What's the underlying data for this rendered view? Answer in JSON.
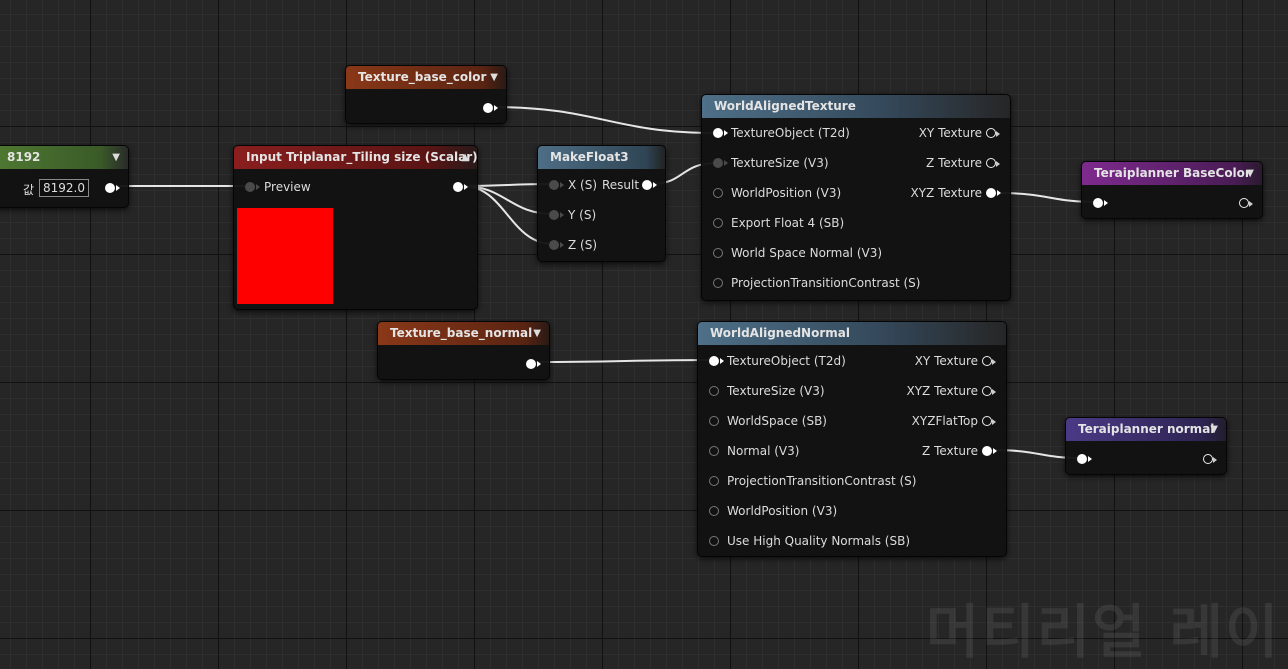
{
  "nodes": {
    "scalar_value": {
      "title": "8192",
      "value_label": "값",
      "value": "8192.0"
    },
    "tiling_param": {
      "title": "Input Triplanar_Tiling size (Scalar)",
      "pin_preview": "Preview",
      "preview_color": "#ff0000"
    },
    "make_float3": {
      "title": "MakeFloat3",
      "pin_x": "X (S)",
      "pin_y": "Y (S)",
      "pin_z": "Z (S)",
      "pin_result": "Result"
    },
    "texture_base_color": {
      "title": "Texture_base_color"
    },
    "texture_base_normal": {
      "title": "Texture_base_normal"
    },
    "world_aligned_texture": {
      "title": "WorldAlignedTexture",
      "inputs": [
        "TextureObject (T2d)",
        "TextureSize (V3)",
        "WorldPosition (V3)",
        "Export Float 4 (SB)",
        "World Space Normal (V3)",
        "ProjectionTransitionContrast (S)"
      ],
      "outputs": [
        "XY Texture",
        "Z Texture",
        "XYZ Texture"
      ]
    },
    "world_aligned_normal": {
      "title": "WorldAlignedNormal",
      "inputs": [
        "TextureObject (T2d)",
        "TextureSize (V3)",
        "WorldSpace (SB)",
        "Normal (V3)",
        "ProjectionTransitionContrast (S)",
        "WorldPosition (V3)",
        "Use High Quality Normals (SB)"
      ],
      "outputs": [
        "XY Texture",
        "XYZ Texture",
        "XYZFlatTop",
        "Z Texture"
      ]
    },
    "terrain_base_color": {
      "title": "Teraiplanner BaseColor"
    },
    "terrain_normal": {
      "title": "Teraiplanner normal"
    }
  },
  "watermark": "머티리얼 레이",
  "colors": {
    "scalar_header": "#5a8a3a",
    "param_header": "#8e1e1e",
    "texture_header": "#8a3a1a",
    "function_header": "#4a6a80",
    "function_call_header": "#3f6075",
    "material_function_header": "#7a2a8a",
    "material_function_normal_header": "#4a3a80",
    "wire": "#e8e8e8"
  }
}
